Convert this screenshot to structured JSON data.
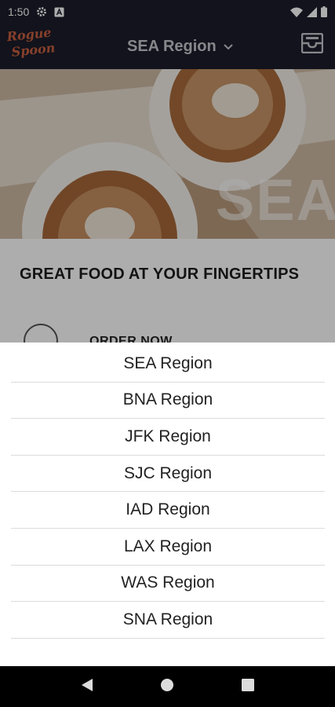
{
  "status_bar": {
    "time": "1:50",
    "icons": [
      "gear-icon",
      "a-badge-icon",
      "wifi-icon",
      "signal-icon",
      "battery-icon"
    ]
  },
  "app_bar": {
    "logo_line1": "Rogue",
    "logo_line2": "Spoon",
    "region_title": "SEA Region",
    "tray_icon": "tray-icon"
  },
  "hero": {
    "badge": "SEA"
  },
  "content": {
    "tagline": "GREAT FOOD AT YOUR FINGERTIPS",
    "order_label": "ORDER NOW"
  },
  "region_sheet": {
    "options": [
      "SEA Region",
      "BNA Region",
      "JFK Region",
      "SJC Region",
      "IAD Region",
      "LAX Region",
      "WAS Region",
      "SNA Region"
    ]
  },
  "nav_bar": {
    "icons": [
      "back-icon",
      "home-icon",
      "recents-icon"
    ]
  },
  "colors": {
    "app_bar_bg": "#1b1c2a",
    "logo": "#c65f3e",
    "region_title": "#c7c7cd"
  }
}
